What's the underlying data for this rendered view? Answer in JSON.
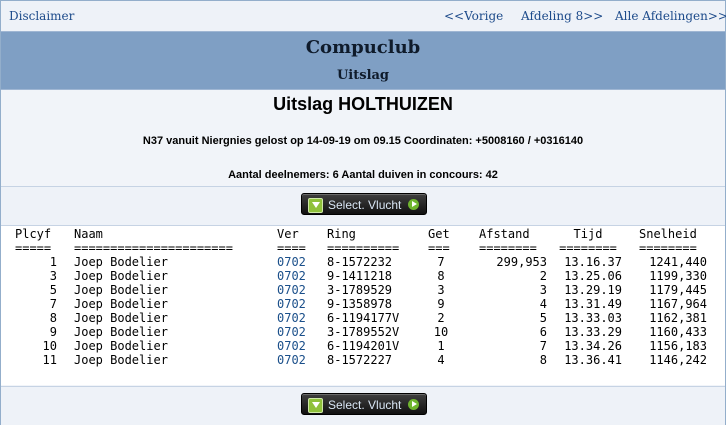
{
  "nav": {
    "disclaimer": "Disclaimer",
    "prev": "<<Vorige",
    "afdeling": "Afdeling 8>>",
    "all": "Alle Afdelingen>>"
  },
  "header": {
    "title": "Compuclub",
    "subtitle": "Uitslag"
  },
  "race": {
    "title": "Uitslag HOLTHUIZEN",
    "release": "N37 vanuit Niergnies gelost op 14-09-19 om 09.15 Coordinaten: +5008160 / +0316140",
    "participants": "Aantal deelnemers: 6 Aantal duiven in concours: 42"
  },
  "button": {
    "select_flight": "Select. Vlucht"
  },
  "table": {
    "headers": [
      "Plcyf",
      "Naam",
      "Ver",
      "Ring",
      "Get",
      "Afstand",
      "Tijd",
      "Snelheid"
    ],
    "separators": [
      "=====",
      "======================",
      "====",
      "==========",
      "===",
      "========",
      "========",
      "========"
    ],
    "rows": [
      [
        "1",
        "Joep Bodelier",
        "0702",
        "8-1572232",
        "7",
        "299,953",
        "13.16.37",
        "1241,440"
      ],
      [
        "3",
        "Joep Bodelier",
        "0702",
        "9-1411218",
        "8",
        "2",
        "13.25.06",
        "1199,330"
      ],
      [
        "5",
        "Joep Bodelier",
        "0702",
        "3-1789529",
        "3",
        "3",
        "13.29.19",
        "1179,445"
      ],
      [
        "7",
        "Joep Bodelier",
        "0702",
        "9-1358978",
        "9",
        "4",
        "13.31.49",
        "1167,964"
      ],
      [
        "8",
        "Joep Bodelier",
        "0702",
        "6-1194177V",
        "2",
        "5",
        "13.33.03",
        "1162,381"
      ],
      [
        "9",
        "Joep Bodelier",
        "0702",
        "3-1789552V",
        "10",
        "6",
        "13.33.29",
        "1160,433"
      ],
      [
        "10",
        "Joep Bodelier",
        "0702",
        "6-1194201V",
        "1",
        "7",
        "13.34.26",
        "1156,183"
      ],
      [
        "11",
        "Joep Bodelier",
        "0702",
        "8-1572227",
        "4",
        "8",
        "13.36.41",
        "1146,242"
      ]
    ]
  }
}
